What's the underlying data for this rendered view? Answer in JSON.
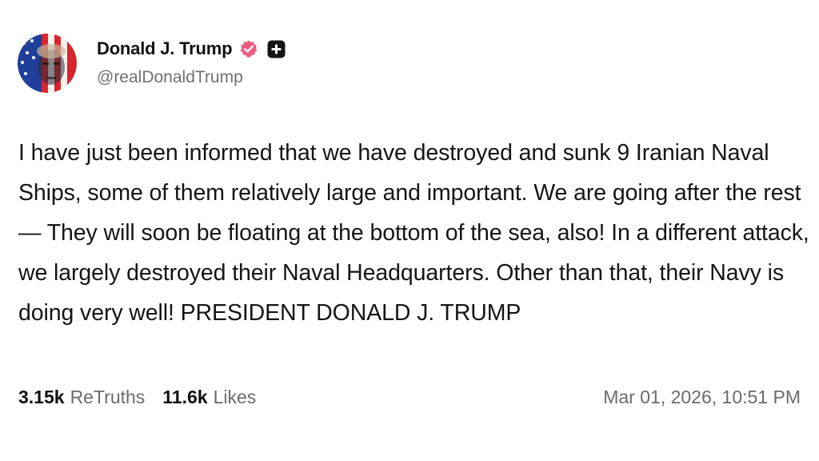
{
  "author": {
    "display_name": "Donald J. Trump",
    "handle": "@realDonaldTrump",
    "verified_icon": "verified-badge-icon",
    "plus_icon": "plus-square-icon",
    "verified_color": "#ec5b82"
  },
  "post": {
    "text": "I have just been informed that we have destroyed and sunk 9 Iranian Naval Ships, some of them relatively large and important. We are going after the rest — They will soon be floating at the bottom of the sea, also! In a different attack, we largely destroyed their Naval Headquarters. Other than that, their Navy is doing very well! PRESIDENT DONALD J. TRUMP"
  },
  "stats": {
    "retruths_count": "3.15k",
    "retruths_label": "ReTruths",
    "likes_count": "11.6k",
    "likes_label": "Likes"
  },
  "timestamp": "Mar 01, 2026, 10:51 PM"
}
